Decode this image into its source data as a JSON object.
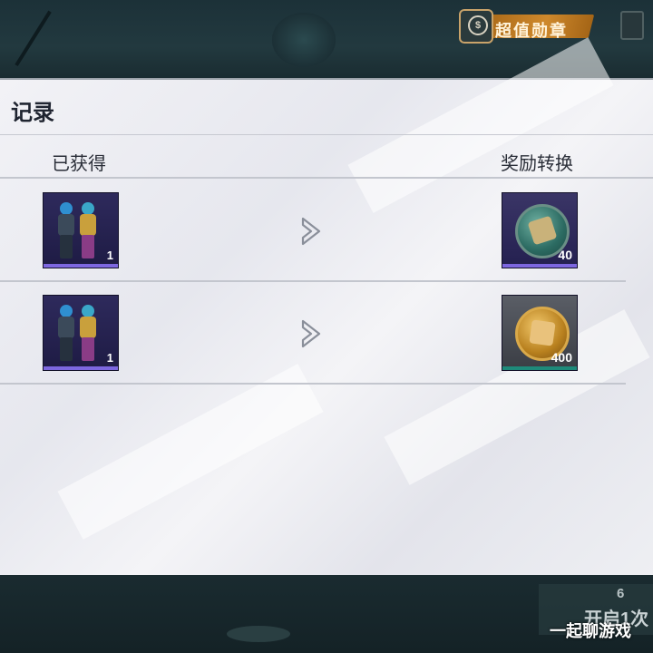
{
  "header": {
    "promo_label": "超值勋章",
    "promo_icon": "dollar-coin-icon"
  },
  "panel": {
    "title": "记录",
    "col_obtained": "已获得",
    "col_reward": "奖励转换"
  },
  "records": [
    {
      "item_icon": "character-outfit-icon",
      "item_qty": "1",
      "reward_icon": "jade-medal-icon",
      "reward_qty": "40",
      "reward_color": "#3e3a6a"
    },
    {
      "item_icon": "character-outfit-icon",
      "item_qty": "1",
      "reward_icon": "gold-medal-icon",
      "reward_qty": "400",
      "reward_color": "#4a4e55"
    }
  ],
  "footer": {
    "open_count": "6",
    "open_label": "开启1次",
    "watermark": "一起聊游戏"
  },
  "colors": {
    "panel_bg": "#eeeff3",
    "item_tile": "#2e2a5c",
    "tile_accent": "#7d67e0",
    "gold_reward_accent": "#1e8a7a"
  }
}
